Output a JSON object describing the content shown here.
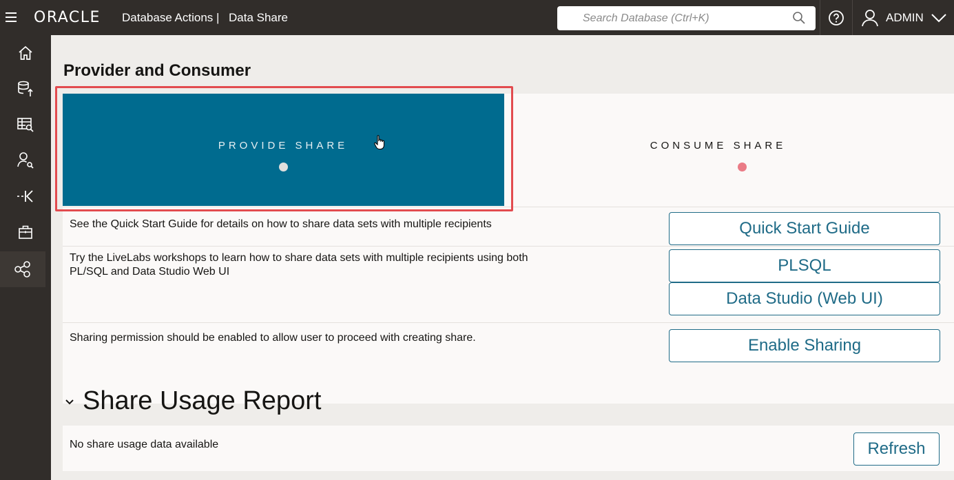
{
  "header": {
    "logo": "ORACLE",
    "app_name": "Database Actions |",
    "page": "Data Share",
    "search_placeholder": "Search Database (Ctrl+K)",
    "user": "ADMIN",
    "icons": [
      "menu-icon",
      "search-icon",
      "help-icon",
      "user-icon",
      "chevron-down-icon"
    ]
  },
  "sidebar": {
    "items": [
      {
        "icon": "home-icon"
      },
      {
        "icon": "data-load-icon"
      },
      {
        "icon": "catalog-icon"
      },
      {
        "icon": "data-insights-icon"
      },
      {
        "icon": "data-transforms-icon"
      },
      {
        "icon": "marketplace-icon"
      },
      {
        "icon": "data-share-icon",
        "active": true
      }
    ]
  },
  "main": {
    "title": "Provider and Consumer",
    "cards": {
      "provide": "PROVIDE SHARE",
      "consume": "CONSUME SHARE"
    },
    "rows": [
      {
        "text": "See the Quick Start Guide for details on how to share data sets with multiple recipients",
        "buttons": [
          "Quick Start Guide"
        ]
      },
      {
        "text": "Try the LiveLabs workshops to learn how to share data sets with multiple recipients using both PL/SQL and Data Studio Web UI",
        "buttons": [
          "PLSQL",
          "Data Studio (Web UI)"
        ]
      },
      {
        "text": "Sharing permission should be enabled to allow user to proceed with creating share.",
        "buttons": [
          "Enable Sharing"
        ]
      }
    ],
    "usage": {
      "title": "Share Usage Report",
      "empty_text": "No share usage data available",
      "refresh_label": "Refresh"
    }
  },
  "colors": {
    "header_bg": "#312d2a",
    "provide_card": "#006b8f",
    "accent": "#1f6b87",
    "consume_dot": "#ea7b86",
    "highlight": "#e24b4f"
  }
}
